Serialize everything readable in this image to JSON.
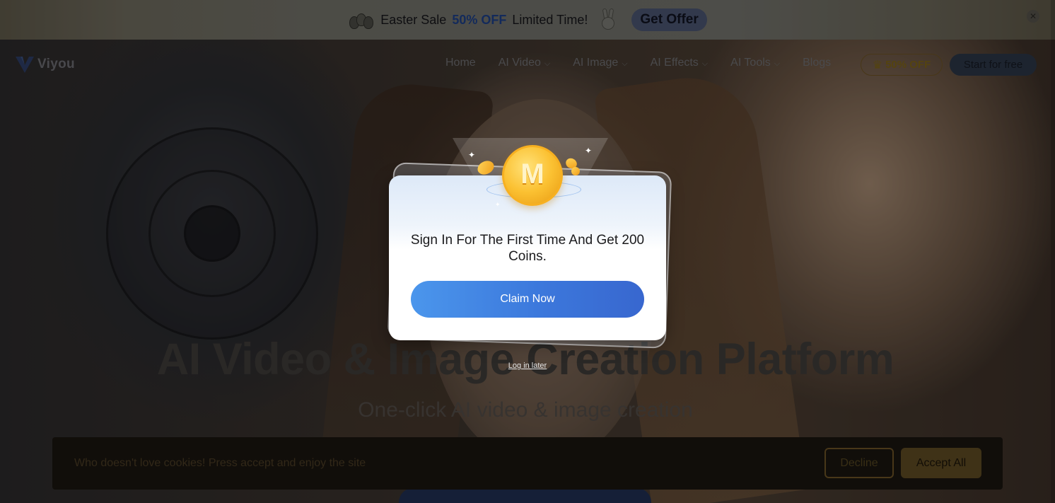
{
  "promo": {
    "text_before": "Easter Sale",
    "highlight": "50% OFF",
    "text_after": "Limited Time!",
    "button": "Get Offer"
  },
  "nav": {
    "logo": "Viyou",
    "items": [
      {
        "label": "Home",
        "has_dropdown": false
      },
      {
        "label": "AI Video",
        "has_dropdown": true
      },
      {
        "label": "AI Image",
        "has_dropdown": true
      },
      {
        "label": "AI Effects",
        "has_dropdown": true
      },
      {
        "label": "AI Tools",
        "has_dropdown": true
      },
      {
        "label": "Blogs",
        "has_dropdown": false
      }
    ],
    "badge": "50% OFF",
    "cta": "Start for free"
  },
  "hero": {
    "title": "AI Video & Image Creation Platform",
    "subtitle": "One-click AI video & image creation"
  },
  "cookie": {
    "text": "Who doesn't love cookies! Press accept and enjoy the site",
    "decline": "Decline",
    "accept": "Accept All"
  },
  "modal": {
    "title": "Sign In For The First Time And Get 200 Coins.",
    "claim_button": "Claim Now",
    "login_later": "Log in later",
    "coin_letter": "M"
  },
  "colors": {
    "accent_blue": "#3c78dc",
    "badge_gold": "#7d6318",
    "modal_bg": "#ffffff"
  }
}
